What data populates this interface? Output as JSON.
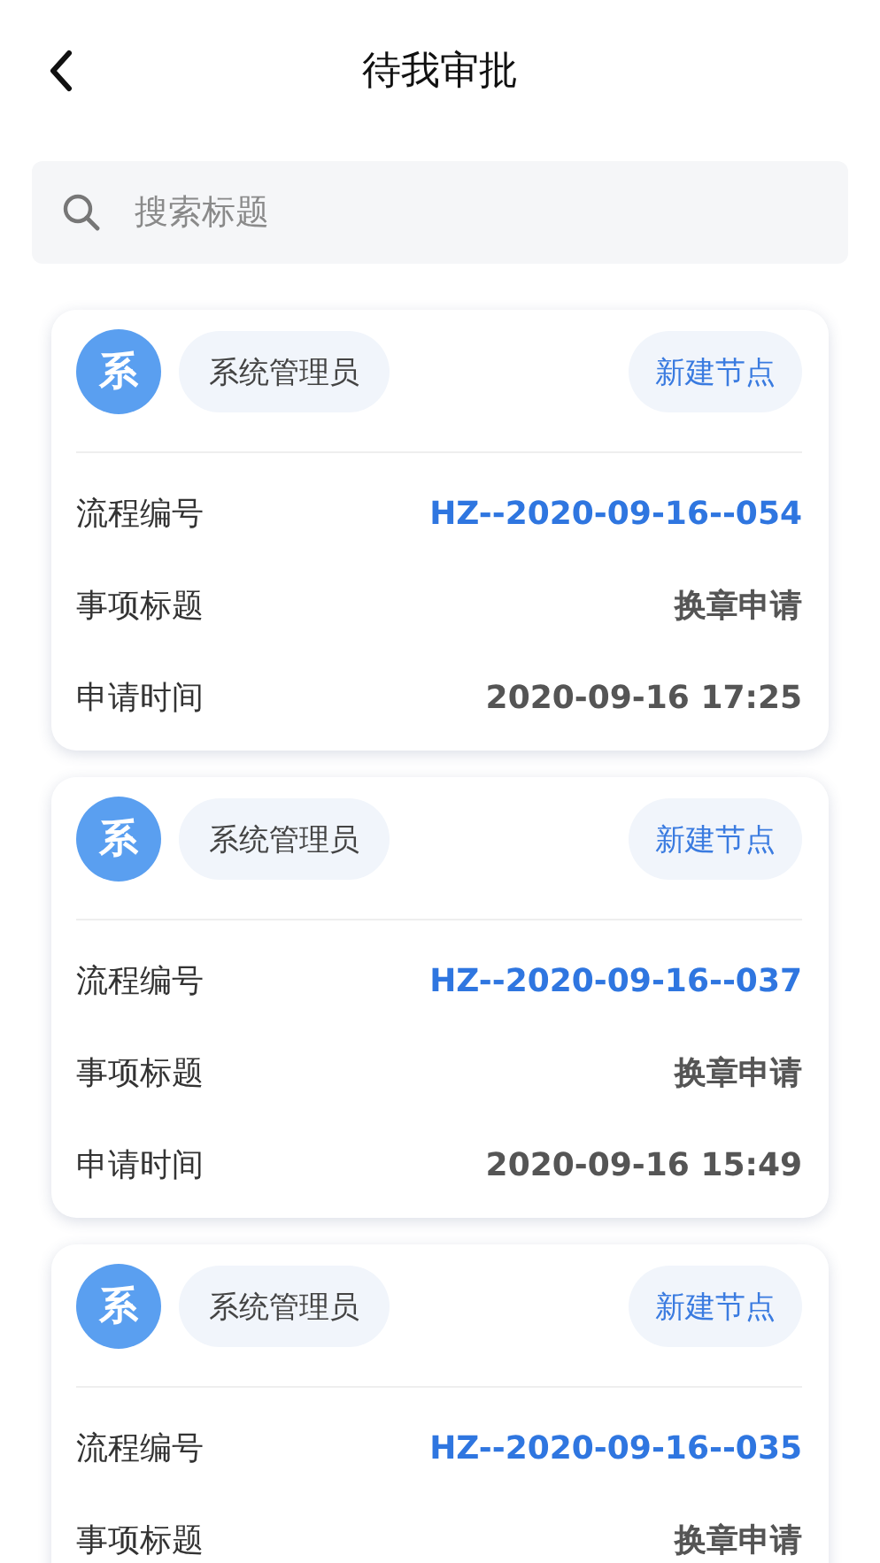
{
  "header": {
    "title": "待我审批"
  },
  "search": {
    "placeholder": "搜索标题"
  },
  "approvals": [
    {
      "avatar": "系",
      "user": "系统管理员",
      "action": "新建节点",
      "fields": [
        {
          "label": "流程编号",
          "value": "HZ--2020-09-16--054",
          "kind": "link"
        },
        {
          "label": "事项标题",
          "value": "换章申请",
          "kind": "text"
        },
        {
          "label": "申请时间",
          "value": "2020-09-16 17:25",
          "kind": "text"
        }
      ]
    },
    {
      "avatar": "系",
      "user": "系统管理员",
      "action": "新建节点",
      "fields": [
        {
          "label": "流程编号",
          "value": "HZ--2020-09-16--037",
          "kind": "link"
        },
        {
          "label": "事项标题",
          "value": "换章申请",
          "kind": "text"
        },
        {
          "label": "申请时间",
          "value": "2020-09-16 15:49",
          "kind": "text"
        }
      ]
    },
    {
      "avatar": "系",
      "user": "系统管理员",
      "action": "新建节点",
      "fields": [
        {
          "label": "流程编号",
          "value": "HZ--2020-09-16--035",
          "kind": "link"
        },
        {
          "label": "事项标题",
          "value": "换章申请",
          "kind": "text"
        }
      ]
    }
  ]
}
